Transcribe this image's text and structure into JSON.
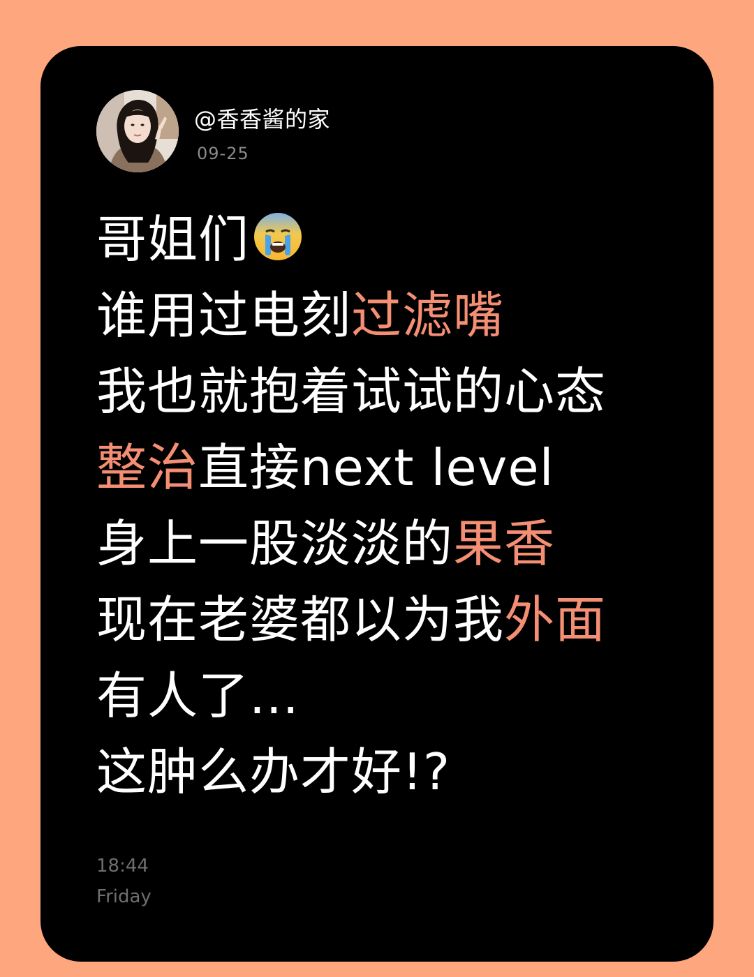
{
  "post": {
    "author": "@香香酱的家",
    "date": "09-25",
    "avatar": "profile-photo-avatar",
    "lines": [
      {
        "segments": [
          {
            "text": "哥姐们",
            "highlight": false
          }
        ],
        "emoji": "loudly-crying-face-icon"
      },
      {
        "segments": [
          {
            "text": "谁用过电刻",
            "highlight": false
          },
          {
            "text": "过滤嘴",
            "highlight": true
          }
        ]
      },
      {
        "segments": [
          {
            "text": "我也就抱着试试的心态",
            "highlight": false
          }
        ]
      },
      {
        "segments": [
          {
            "text": "整治",
            "highlight": true
          },
          {
            "text": "直接next level",
            "highlight": false
          }
        ]
      },
      {
        "segments": [
          {
            "text": "身上一股淡淡的",
            "highlight": false
          },
          {
            "text": "果香",
            "highlight": true
          }
        ]
      },
      {
        "segments": [
          {
            "text": "现在老婆都以为我",
            "highlight": false
          },
          {
            "text": "外面",
            "highlight": true
          }
        ]
      },
      {
        "segments": [
          {
            "text": "有人了...",
            "highlight": false
          }
        ]
      },
      {
        "segments": [
          {
            "text": "这肿么办才好!?",
            "highlight": false
          }
        ]
      }
    ],
    "footer_time": "18:44",
    "footer_day": "Friday"
  },
  "colors": {
    "background": "#FEA67E",
    "card": "#000000",
    "text": "#FFFFFF",
    "highlight": "#F58F74",
    "muted": "#8B8B8B"
  }
}
